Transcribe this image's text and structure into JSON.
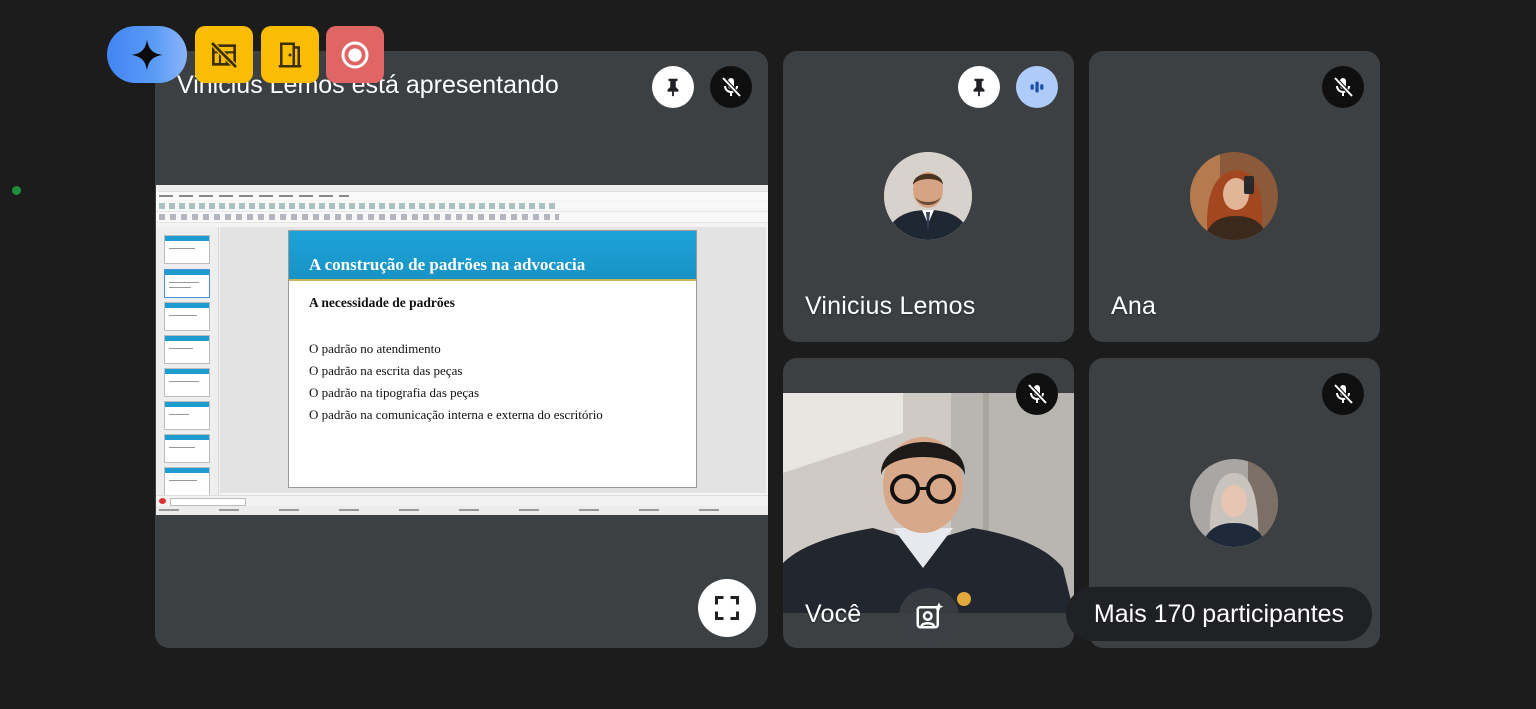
{
  "presenter_tile": {
    "title": "Vinicius Lemos está apresentando"
  },
  "slide": {
    "title": "A construção de padrões na advocacia",
    "subtitle": "A necessidade de padrões",
    "bullets": [
      "O padrão no atendimento",
      "O padrão na escrita das peças",
      "O padrão na tipografia das peças",
      "O padrão na comunicação interna e externa do escritório"
    ]
  },
  "participants": [
    {
      "name": "Vinicius Lemos",
      "muted": false,
      "speaking": true,
      "pinnable": true
    },
    {
      "name": "Ana",
      "muted": true
    },
    {
      "name": "Você",
      "muted": true
    },
    {
      "name": "",
      "muted": true
    }
  ],
  "more_participants": "Mais 170 participantes",
  "toolbar_icons": [
    "gemini-sparkle-icon",
    "no-lab-icon",
    "door-icon",
    "record-icon"
  ],
  "colors": {
    "background": "#1c1c1c",
    "tile": "#3c4043",
    "gemini_blue": "#4285f4",
    "badge_yellow": "#fbbc04",
    "record_red": "#e06666",
    "speaking_blue": "#aecbfa",
    "slide_header": "#1da3d8"
  }
}
